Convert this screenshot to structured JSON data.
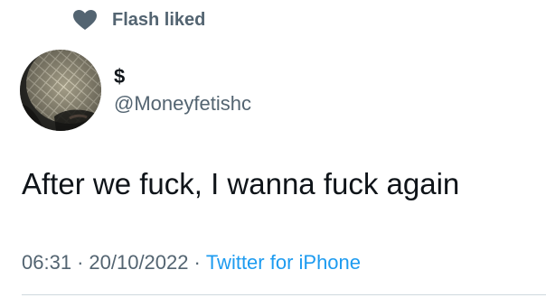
{
  "social_context": {
    "icon": "heart-icon",
    "text": "Flash liked"
  },
  "author": {
    "display_name": "$",
    "handle": "@Moneyfetishc",
    "avatar": "avatar-image"
  },
  "tweet": {
    "text": "After we fuck, I wanna fuck again"
  },
  "meta": {
    "time": "06:31",
    "separator": "·",
    "date": "20/10/2022",
    "source": "Twitter for iPhone"
  },
  "colors": {
    "text_primary": "#0f1419",
    "text_secondary": "#536471",
    "link": "#1d9bf0",
    "divider": "#cfd9de"
  }
}
